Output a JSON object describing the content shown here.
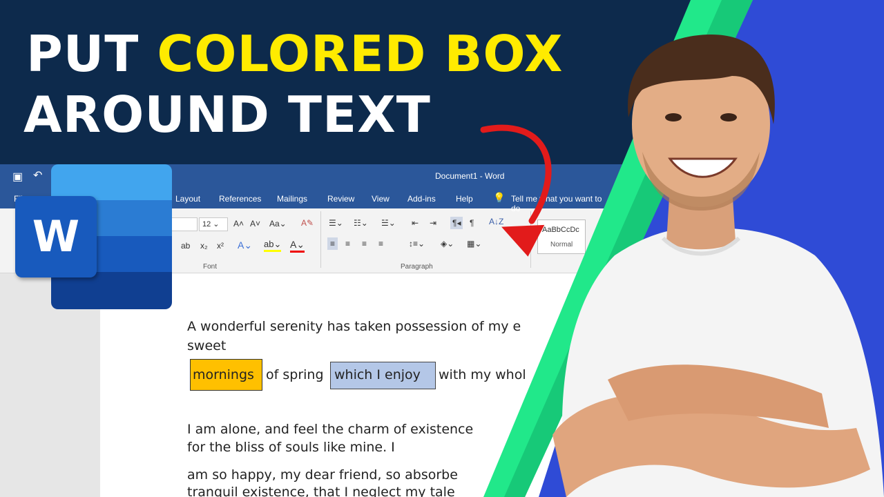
{
  "thumbnail": {
    "headline_line1_plain": "PUT ",
    "headline_line1_highlight": "COLORED BOX",
    "headline_line2": "AROUND TEXT",
    "colors": {
      "navy": "#0d2a4c",
      "highlight_yellow": "#ffeb00",
      "green": "#21e88a",
      "blue": "#2f4bd6",
      "arrow_red": "#e21b1b"
    }
  },
  "word": {
    "window_title": "Document1  -  Word",
    "logo_letter": "W",
    "file_menu": "File",
    "menu": [
      "Layout",
      "References",
      "Mailings",
      "Review",
      "View",
      "Add-ins",
      "Help"
    ],
    "tell_me": "Tell me what you want to do",
    "font_size": "12",
    "style_preview": "AaBbCcDc",
    "style_name": "Normal",
    "group_font": "Font",
    "group_paragraph": "Paragraph",
    "icons": [
      "save-icon",
      "undo-icon",
      "lightbulb-icon",
      "bullets-icon",
      "numbering-icon",
      "multilevel-list-icon",
      "decrease-indent-icon",
      "increase-indent-icon",
      "sort-icon",
      "show-formatting-icon",
      "align-left-icon",
      "center-icon",
      "align-right-icon",
      "justify-icon",
      "line-spacing-icon",
      "shading-icon",
      "borders-icon",
      "grow-font-icon",
      "shrink-font-icon",
      "change-case-icon",
      "clear-formatting-icon",
      "text-effects-icon",
      "highlight-icon",
      "font-color-icon",
      "subscript-icon",
      "superscript-icon"
    ]
  },
  "document": {
    "line1": "A wonderful serenity has taken possession of my e",
    "line2": "sweet",
    "box1_text": "mornings",
    "mid_text": "of spring",
    "box2_text": "which I enjoy",
    "after_text": "with my whol",
    "para2_line1": "I am alone, and feel the charm of existence",
    "para2_line2": "for the bliss of souls like mine. I",
    "para3_line1": " am so happy, my dear friend, so absorbe",
    "para3_line2": "tranquil existence, that I neglect my tale"
  }
}
